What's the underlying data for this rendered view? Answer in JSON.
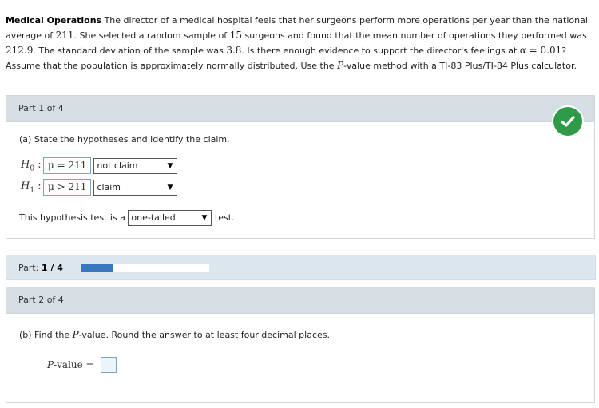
{
  "problem": {
    "title": "Medical Operations",
    "seg1": " The director of a medical hospital feels that her surgeons perform more operations per year than the national average of ",
    "v_national": "211",
    "seg2": ". She selected a random sample of ",
    "v_n": "15",
    "seg3": " surgeons and found that the mean number of operations they performed was ",
    "v_mean": "212.9",
    "seg4": ". The standard deviation of the sample was ",
    "v_sd": "3.8",
    "seg5": ". Is there enough evidence to support the director's feelings at ",
    "v_alpha": "α = 0.01",
    "seg6": "? Assume that the population is approximately normally distributed. Use the ",
    "v_p": "P",
    "seg7": "-value method with a TI-83 Plus/TI-84 Plus calculator."
  },
  "part1": {
    "header": "Part 1 of 4",
    "question": "(a) State the hypotheses and identify the claim.",
    "h0_label": "H",
    "h0_sub": "0",
    "h0_colon": ":",
    "h0_value": "μ = 211",
    "h0_select": "not claim",
    "h1_label": "H",
    "h1_sub": "1",
    "h1_colon": ":",
    "h1_value": "μ > 211",
    "h1_select": "claim",
    "test_prefix": "This hypothesis test is a",
    "test_select": "one-tailed",
    "test_suffix": "test.",
    "check_icon": "checkmark-icon",
    "check_color": "#2f9a48"
  },
  "progress": {
    "label": "Part:",
    "value": "1 / 4",
    "fraction": 0.25,
    "bar_color": "#3b77bf"
  },
  "part2": {
    "header": "Part 2 of 4",
    "q_prefix": "(b) Find the ",
    "q_p": "P",
    "q_suffix": "-value. Round the answer to at least four decimal places.",
    "pvalue_p": "P",
    "pvalue_label": "-value =",
    "pvalue_input": ""
  },
  "icons": {
    "dropdown": "▼"
  }
}
